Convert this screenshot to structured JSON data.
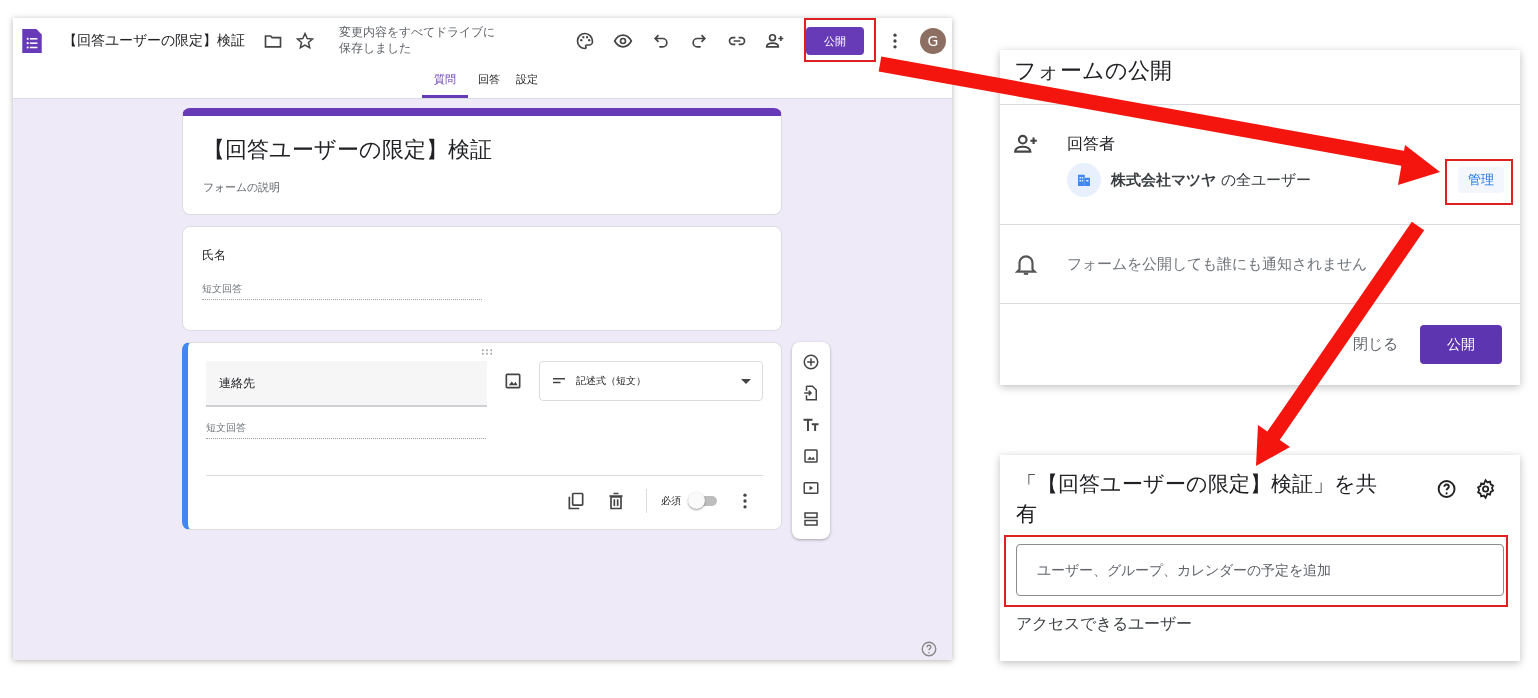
{
  "forms_editor": {
    "title": "【回答ユーザーの限定】検証",
    "save_status": "変更内容をすべてドライブに保存しました",
    "publish_button": "公開",
    "avatar": "G",
    "tabs": [
      {
        "label": "質問",
        "selected": true
      },
      {
        "label": "回答",
        "selected": false
      },
      {
        "label": "設定",
        "selected": false
      }
    ],
    "header_card": {
      "title": "【回答ユーザーの限定】検証",
      "description_placeholder": "フォームの説明"
    },
    "questions": [
      {
        "title": "氏名",
        "answer_hint": "短文回答",
        "active": false
      },
      {
        "title": "連絡先",
        "answer_hint": "短文回答",
        "active": true,
        "type_label": "記述式（短文）",
        "required_label": "必須",
        "required": false
      }
    ]
  },
  "publish_dialog": {
    "title": "フォームの公開",
    "respondents_label": "回答者",
    "audience": "**株式会社マツヤ** の全ユーザー",
    "manage_button": "管理",
    "notice": "フォームを公開しても誰にも通知されません",
    "close_button": "閉じる",
    "publish_button": "公開"
  },
  "share_dialog": {
    "title": "「【回答ユーザーの限定】検証」を共有",
    "add_field": {
      "placeholder": "ユーザー、グループ、カレンダーの予定を追加"
    },
    "access_heading": "アクセスできるユーザー"
  }
}
